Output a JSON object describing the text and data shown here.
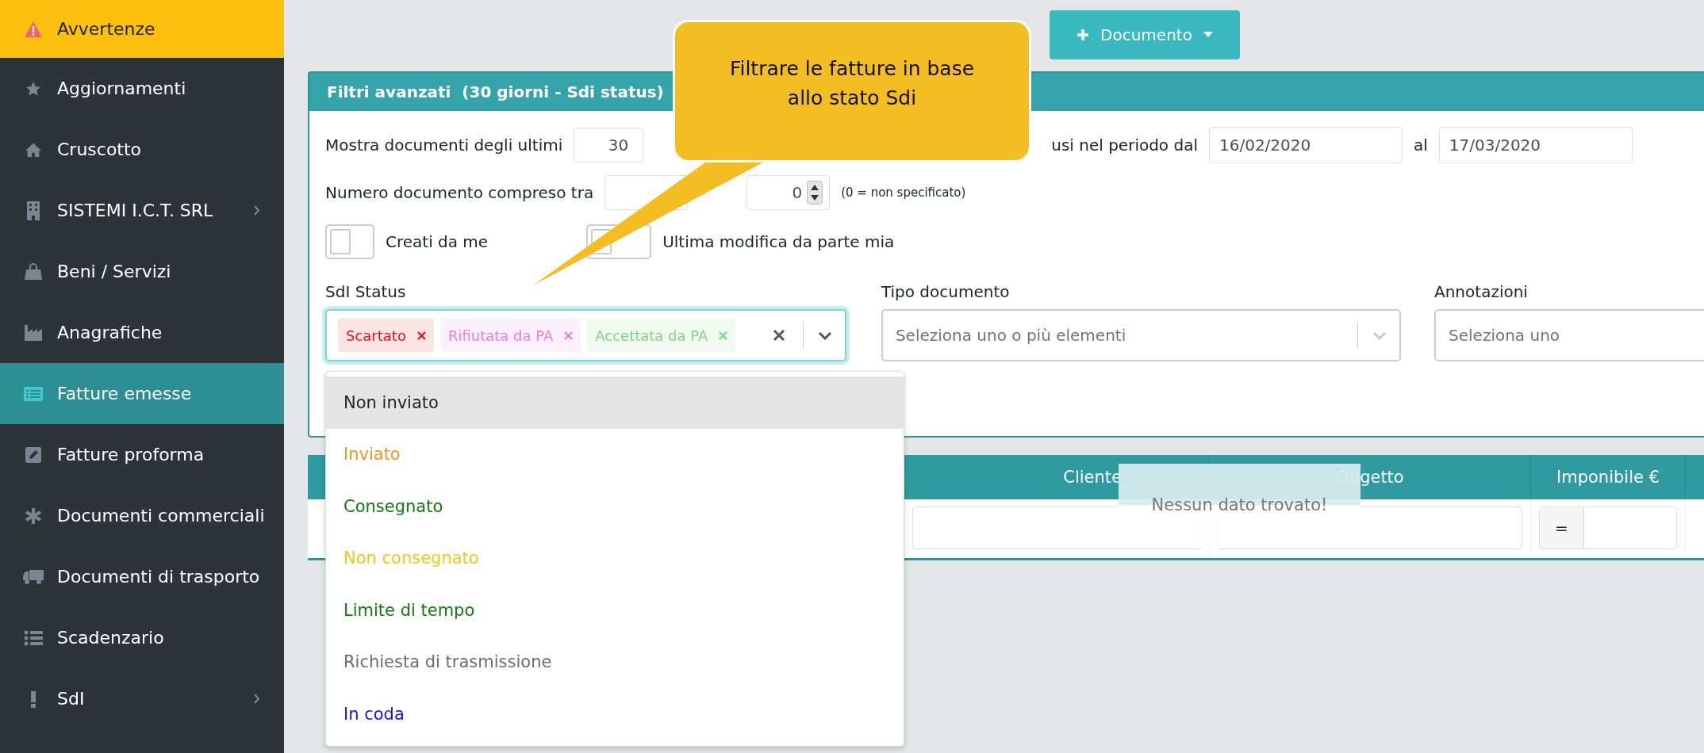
{
  "sidebar": {
    "items": [
      {
        "label": "Avvertenze",
        "kind": "warning",
        "selected": false,
        "expandable": false
      },
      {
        "label": "Aggiornamenti",
        "kind": "link",
        "selected": false,
        "expandable": false
      },
      {
        "label": "Cruscotto",
        "kind": "link",
        "selected": false,
        "expandable": false
      },
      {
        "label": "SISTEMI I.C.T. SRL",
        "kind": "link",
        "selected": false,
        "expandable": true
      },
      {
        "label": "Beni / Servizi",
        "kind": "link",
        "selected": false,
        "expandable": false
      },
      {
        "label": "Anagrafiche",
        "kind": "link",
        "selected": false,
        "expandable": false
      },
      {
        "label": "Fatture emesse",
        "kind": "link",
        "selected": true,
        "expandable": false
      },
      {
        "label": "Fatture proforma",
        "kind": "link",
        "selected": false,
        "expandable": false
      },
      {
        "label": "Documenti commerciali",
        "kind": "link",
        "selected": false,
        "expandable": false
      },
      {
        "label": "Documenti di trasporto",
        "kind": "link",
        "selected": false,
        "expandable": false
      },
      {
        "label": "Scadenzario",
        "kind": "link",
        "selected": false,
        "expandable": false
      },
      {
        "label": "SdI",
        "kind": "link",
        "selected": false,
        "expandable": true
      }
    ]
  },
  "toolbar": {
    "new_button": "Documento"
  },
  "callout": {
    "text": "Filtrare le fatture in base allo stato Sdi"
  },
  "filters": {
    "title": "Filtri avanzati  (30 giorni - Sdi status)",
    "days_label": "Mostra documenti degli ultimi",
    "days_value": "30",
    "period_label": "usi nel periodo dal",
    "date_from": "16/02/2020",
    "date_sep": "al",
    "date_to": "17/03/2020",
    "number_label": "Numero documento compreso tra",
    "number_to": "0",
    "number_note": "(0 = non specificato)",
    "toggles": [
      {
        "label": "Creati da me",
        "on": false
      },
      {
        "label": "Ultima modifica da parte mia",
        "on": false
      }
    ],
    "sdi_status": {
      "label": "SdI Status",
      "tags": [
        {
          "label": "Scartato",
          "color": "#e8141a"
        },
        {
          "label": "Rifiutata da PA",
          "color": "#e57ee5"
        },
        {
          "label": "Accettata da PA",
          "color": "#7fd67f"
        }
      ],
      "options": [
        {
          "label": "Non inviato",
          "color": "#212529",
          "highlighted": true
        },
        {
          "label": "Inviato",
          "color": "#f7931e",
          "highlighted": false
        },
        {
          "label": "Consegnato",
          "color": "#13780f",
          "highlighted": false
        },
        {
          "label": "Non consegnato",
          "color": "#f5c518",
          "highlighted": false
        },
        {
          "label": "Limite di tempo",
          "color": "#13780f",
          "highlighted": false
        },
        {
          "label": "Richiesta di trasmissione",
          "color": "#6c6c6c",
          "highlighted": false
        },
        {
          "label": "In coda",
          "color": "#1414ef",
          "highlighted": false
        }
      ]
    },
    "doc_type": {
      "label": "Tipo documento",
      "placeholder": "Seleziona uno o più elementi"
    },
    "notes": {
      "label": "Annotazioni",
      "placeholder": "Seleziona uno"
    }
  },
  "table": {
    "columns": [
      "Cliente",
      "Oggetto",
      "Imponibile €"
    ],
    "operator": "=",
    "empty_message": "Nessun dato trovato!"
  }
}
